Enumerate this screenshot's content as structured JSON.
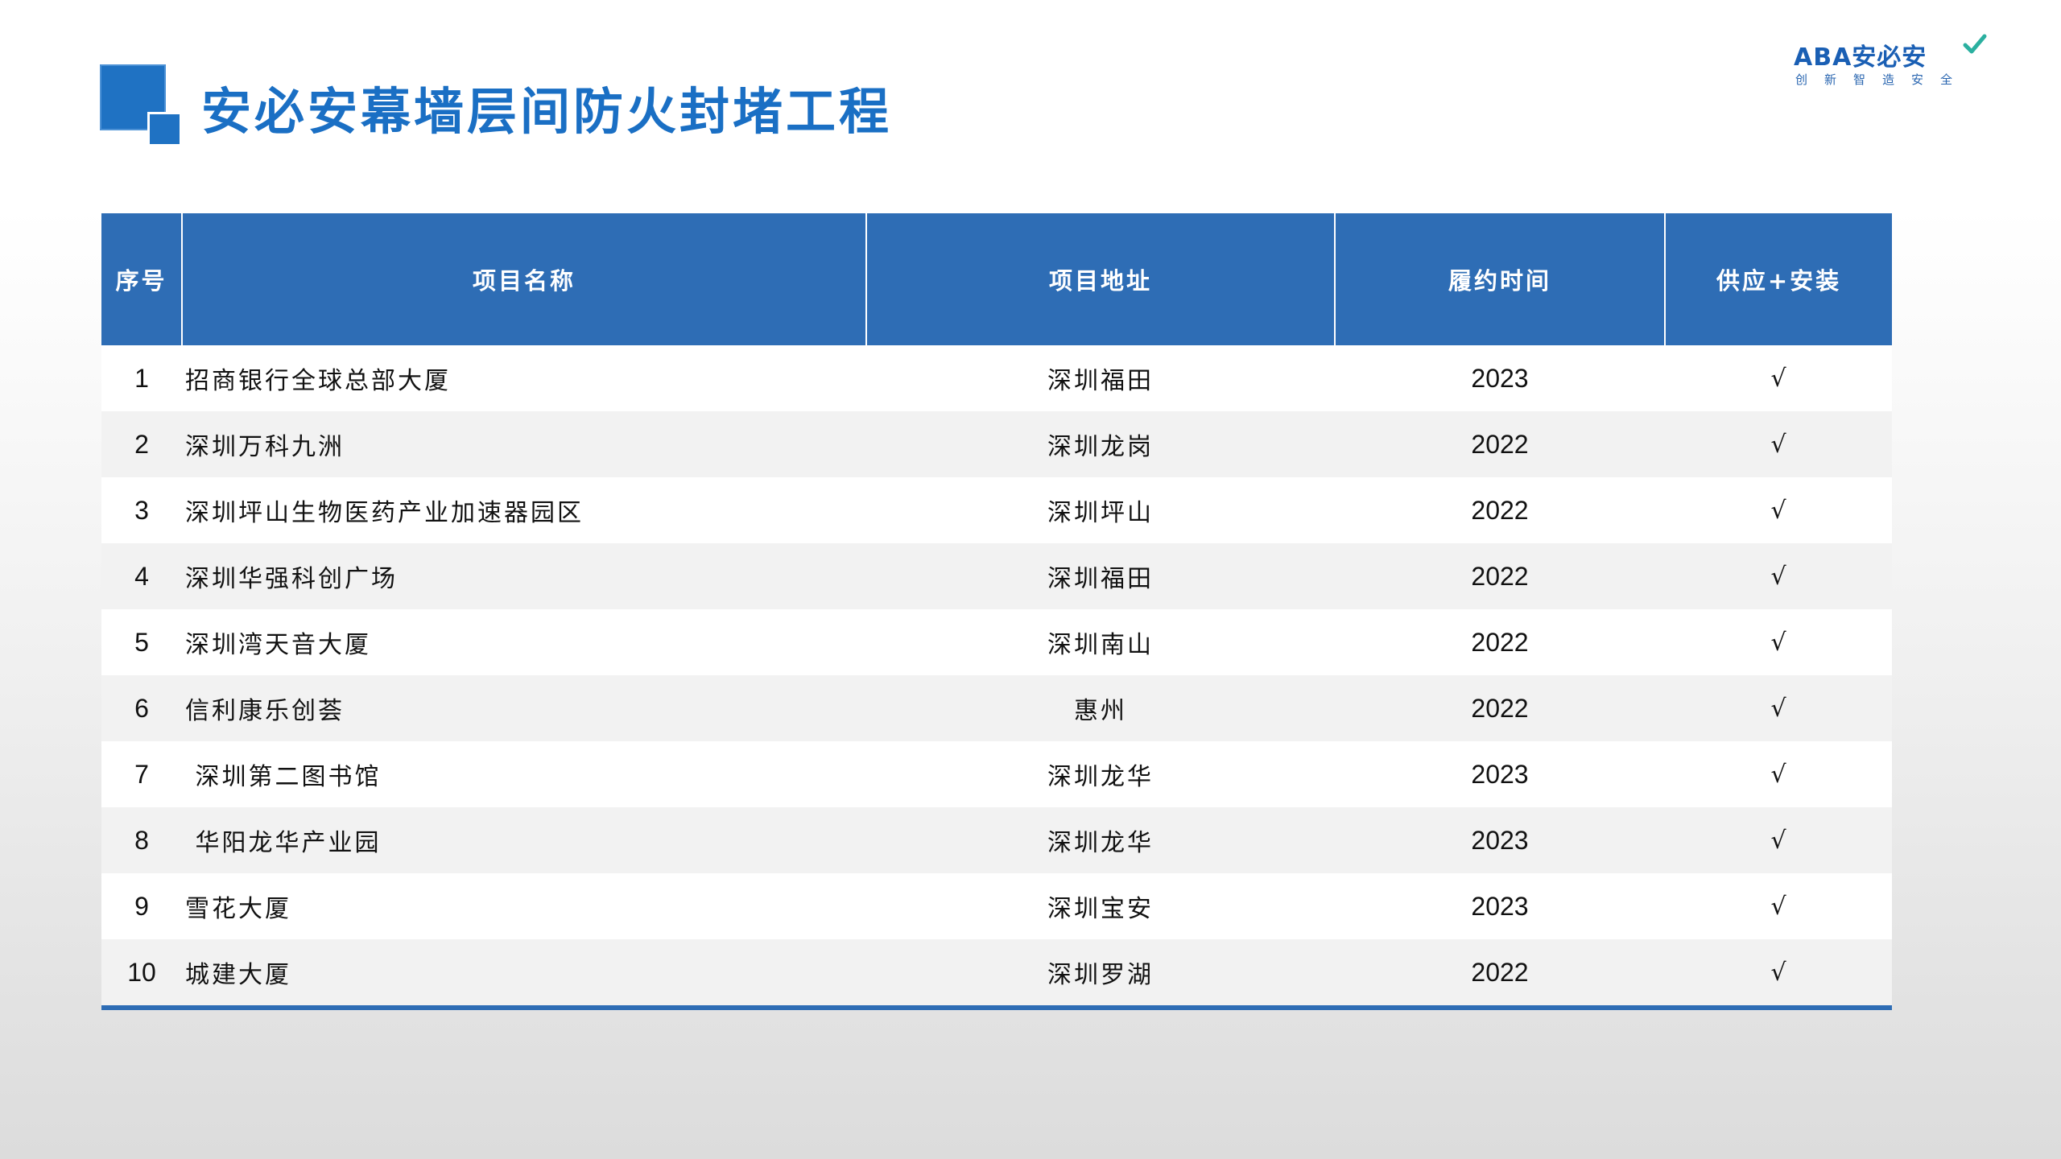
{
  "header": {
    "title": "安必安幕墙层间防火封堵工程"
  },
  "logo": {
    "brand": "ABA安必安",
    "slogan": "创新智造安全",
    "accent_color": "#1a5fb4",
    "check_color": "#2bb0a0"
  },
  "table": {
    "header_color": "#2e6db5",
    "columns": [
      "序号",
      "项目名称",
      "项目地址",
      "履约时间",
      "供应+安装"
    ],
    "rows": [
      {
        "no": "1",
        "name": "招商银行全球总部大厦",
        "address": "深圳福田",
        "year": "2023",
        "supply_install": "√"
      },
      {
        "no": "2",
        "name": "深圳万科九洲",
        "address": "深圳龙岗",
        "year": "2022",
        "supply_install": "√"
      },
      {
        "no": "3",
        "name": "深圳坪山生物医药产业加速器园区",
        "address": "深圳坪山",
        "year": "2022",
        "supply_install": "√"
      },
      {
        "no": "4",
        "name": "深圳华强科创广场",
        "address": "深圳福田",
        "year": "2022",
        "supply_install": "√"
      },
      {
        "no": "5",
        "name": "深圳湾天音大厦",
        "address": "深圳南山",
        "year": "2022",
        "supply_install": "√"
      },
      {
        "no": "6",
        "name": "信利康乐创荟",
        "address": "惠州",
        "year": "2022",
        "supply_install": "√"
      },
      {
        "no": "7",
        "name": " 深圳第二图书馆",
        "address": "深圳龙华",
        "year": "2023",
        "supply_install": "√"
      },
      {
        "no": "8",
        "name": " 华阳龙华产业园",
        "address": "深圳龙华",
        "year": "2023",
        "supply_install": "√"
      },
      {
        "no": "9",
        "name": "雪花大厦",
        "address": "深圳宝安",
        "year": "2023",
        "supply_install": "√"
      },
      {
        "no": "10",
        "name": "城建大厦",
        "address": "深圳罗湖",
        "year": "2022",
        "supply_install": "√"
      }
    ]
  }
}
